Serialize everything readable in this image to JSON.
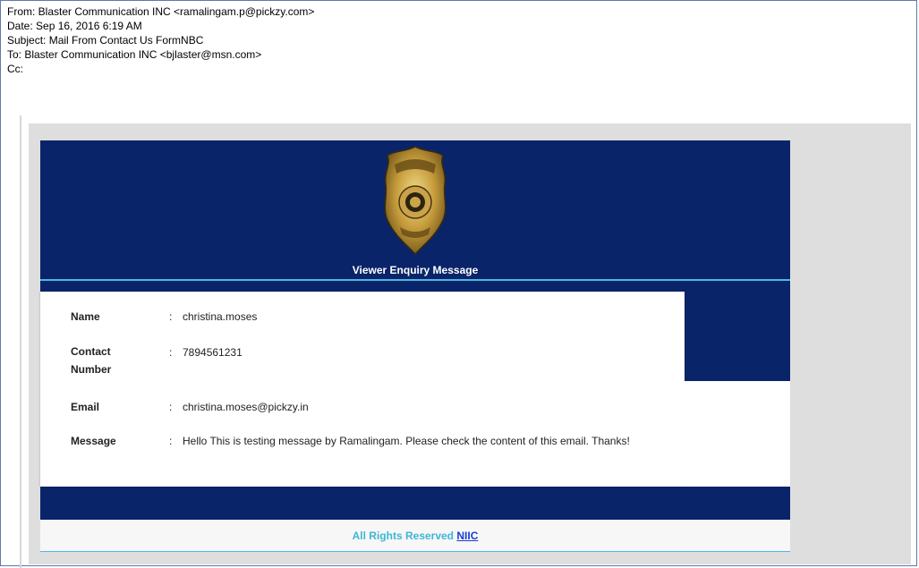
{
  "email_header": {
    "from": "From: Blaster Communication INC <ramalingam.p@pickzy.com>",
    "date": "Date: Sep 16, 2016 6:19 AM",
    "subject": "Subject: Mail From Contact Us FormNBC",
    "to": "To: Blaster Communication INC <bjlaster@msn.com>",
    "cc": "Cc:"
  },
  "card": {
    "title": "Viewer Enquiry Message",
    "logo_icon": "police-badge-icon",
    "fields": [
      {
        "label": "Name",
        "sep": ":",
        "value": "christina.moses"
      },
      {
        "label": "Contact Number",
        "sep": ":",
        "value": "7894561231"
      },
      {
        "label": "Email",
        "sep": ":",
        "value": "christina.moses@pickzy.in"
      },
      {
        "label": "Message",
        "sep": ":",
        "value": "Hello This is testing message by Ramalingam. Please check the content of this email. Thanks!"
      }
    ]
  },
  "footer": {
    "text": "All Rights Reserved",
    "link": "NIIC"
  },
  "colors": {
    "panel_blue": "#0a2469",
    "accent_cyan": "#4fb7e3",
    "footer_text": "#3fb5d6",
    "link": "#1a3bd6"
  }
}
